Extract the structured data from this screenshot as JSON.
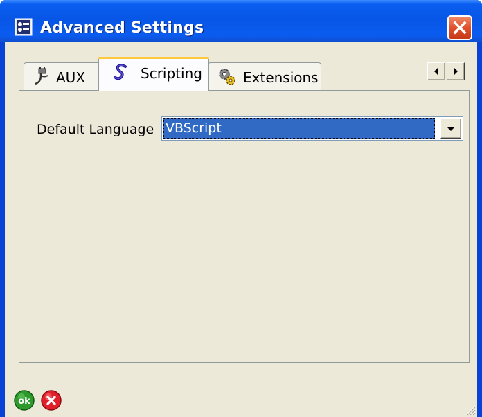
{
  "window": {
    "title": "Advanced Settings",
    "title_icon": "settings-window-icon",
    "close_icon": "close-icon"
  },
  "tabs": [
    {
      "label": "AUX",
      "icon": "aux-cable-icon",
      "selected": false
    },
    {
      "label": "Scripting",
      "icon": "scripting-icon",
      "selected": true
    },
    {
      "label": "Extensions",
      "icon": "extensions-gears-icon",
      "selected": false
    }
  ],
  "tab_scroll": {
    "left_icon": "arrow-left-icon",
    "right_icon": "arrow-right-icon"
  },
  "scripting": {
    "default_language_label": "Default Language",
    "default_language_value": "VBScript"
  },
  "footer": {
    "ok_label": "ok",
    "ok_icon": "ok-icon",
    "cancel_icon": "cancel-icon"
  },
  "colors": {
    "titlebar": "#0a5cf0",
    "face": "#ece9d8",
    "selection": "#316ac5",
    "close": "#e0512c",
    "ok": "#2e9a2c",
    "cancel": "#e0202a"
  }
}
